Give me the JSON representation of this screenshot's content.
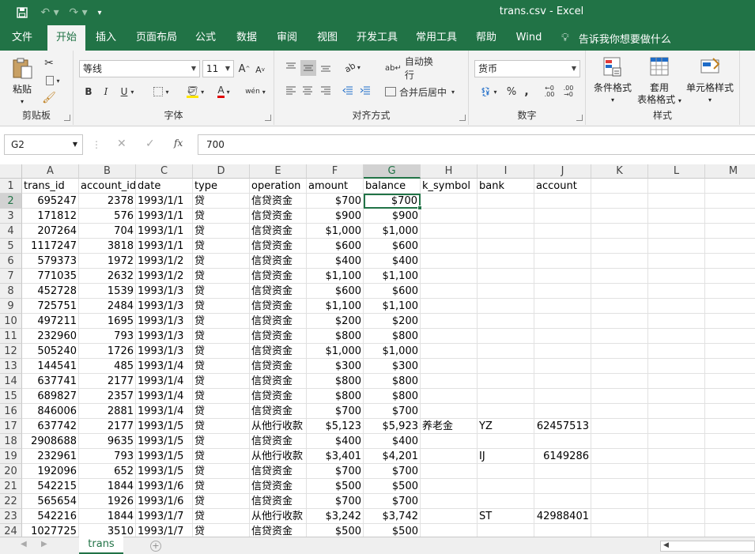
{
  "title": "trans.csv  -  Excel",
  "tabs": [
    "文件",
    "开始",
    "插入",
    "页面布局",
    "公式",
    "数据",
    "审阅",
    "视图",
    "开发工具",
    "常用工具",
    "帮助",
    "Wind"
  ],
  "tell_me": "告诉我你想要做什么",
  "ribbon": {
    "clipboard": {
      "paste": "粘贴",
      "label": "剪贴板"
    },
    "font": {
      "name": "等线",
      "size": "11",
      "label": "字体",
      "grow": "A",
      "shrink": "A",
      "bold": "B",
      "italic": "I",
      "underline": "U",
      "color_letter": "A",
      "phonetic": "wén"
    },
    "alignment": {
      "wrap": "自动换行",
      "merge": "合并后居中",
      "label": "对齐方式"
    },
    "number": {
      "format": "货币",
      "percent": "%",
      "comma": ",",
      "label": "数字",
      "inc": ".00",
      "dec": ".00"
    },
    "styles": {
      "cond": "条件格式",
      "table1": "套用",
      "table2": "表格格式",
      "cell": "单元格样式",
      "label": "样式"
    }
  },
  "namebox": "G2",
  "formula": "700",
  "fx": "fx",
  "columns": [
    "A",
    "B",
    "C",
    "D",
    "E",
    "F",
    "G",
    "H",
    "I",
    "J",
    "K",
    "L",
    "M"
  ],
  "rows": [
    [
      "trans_id",
      "account_id",
      "date",
      "type",
      "operation",
      "amount",
      "balance",
      "k_symbol",
      "bank",
      "account"
    ],
    [
      "695247",
      "2378",
      "1993/1/1",
      "贷",
      "信贷资金",
      "$700",
      "$700",
      "",
      "",
      ""
    ],
    [
      "171812",
      "576",
      "1993/1/1",
      "贷",
      "信贷资金",
      "$900",
      "$900",
      "",
      "",
      ""
    ],
    [
      "207264",
      "704",
      "1993/1/1",
      "贷",
      "信贷资金",
      "$1,000",
      "$1,000",
      "",
      "",
      ""
    ],
    [
      "1117247",
      "3818",
      "1993/1/1",
      "贷",
      "信贷资金",
      "$600",
      "$600",
      "",
      "",
      ""
    ],
    [
      "579373",
      "1972",
      "1993/1/2",
      "贷",
      "信贷资金",
      "$400",
      "$400",
      "",
      "",
      ""
    ],
    [
      "771035",
      "2632",
      "1993/1/2",
      "贷",
      "信贷资金",
      "$1,100",
      "$1,100",
      "",
      "",
      ""
    ],
    [
      "452728",
      "1539",
      "1993/1/3",
      "贷",
      "信贷资金",
      "$600",
      "$600",
      "",
      "",
      ""
    ],
    [
      "725751",
      "2484",
      "1993/1/3",
      "贷",
      "信贷资金",
      "$1,100",
      "$1,100",
      "",
      "",
      ""
    ],
    [
      "497211",
      "1695",
      "1993/1/3",
      "贷",
      "信贷资金",
      "$200",
      "$200",
      "",
      "",
      ""
    ],
    [
      "232960",
      "793",
      "1993/1/3",
      "贷",
      "信贷资金",
      "$800",
      "$800",
      "",
      "",
      ""
    ],
    [
      "505240",
      "1726",
      "1993/1/3",
      "贷",
      "信贷资金",
      "$1,000",
      "$1,000",
      "",
      "",
      ""
    ],
    [
      "144541",
      "485",
      "1993/1/4",
      "贷",
      "信贷资金",
      "$300",
      "$300",
      "",
      "",
      ""
    ],
    [
      "637741",
      "2177",
      "1993/1/4",
      "贷",
      "信贷资金",
      "$800",
      "$800",
      "",
      "",
      ""
    ],
    [
      "689827",
      "2357",
      "1993/1/4",
      "贷",
      "信贷资金",
      "$800",
      "$800",
      "",
      "",
      ""
    ],
    [
      "846006",
      "2881",
      "1993/1/4",
      "贷",
      "信贷资金",
      "$700",
      "$700",
      "",
      "",
      ""
    ],
    [
      "637742",
      "2177",
      "1993/1/5",
      "贷",
      "从他行收款",
      "$5,123",
      "$5,923",
      "养老金",
      "YZ",
      "62457513"
    ],
    [
      "2908688",
      "9635",
      "1993/1/5",
      "贷",
      "信贷资金",
      "$400",
      "$400",
      "",
      "",
      ""
    ],
    [
      "232961",
      "793",
      "1993/1/5",
      "贷",
      "从他行收款",
      "$3,401",
      "$4,201",
      "",
      "IJ",
      "6149286"
    ],
    [
      "192096",
      "652",
      "1993/1/5",
      "贷",
      "信贷资金",
      "$700",
      "$700",
      "",
      "",
      ""
    ],
    [
      "542215",
      "1844",
      "1993/1/6",
      "贷",
      "信贷资金",
      "$500",
      "$500",
      "",
      "",
      ""
    ],
    [
      "565654",
      "1926",
      "1993/1/6",
      "贷",
      "信贷资金",
      "$700",
      "$700",
      "",
      "",
      ""
    ],
    [
      "542216",
      "1844",
      "1993/1/7",
      "贷",
      "从他行收款",
      "$3,242",
      "$3,742",
      "",
      "ST",
      "42988401"
    ],
    [
      "1027725",
      "3510",
      "1993/1/7",
      "贷",
      "信贷资金",
      "$500",
      "$500",
      "",
      "",
      ""
    ]
  ],
  "sheet_tab": "trans",
  "add_sheet": "+"
}
